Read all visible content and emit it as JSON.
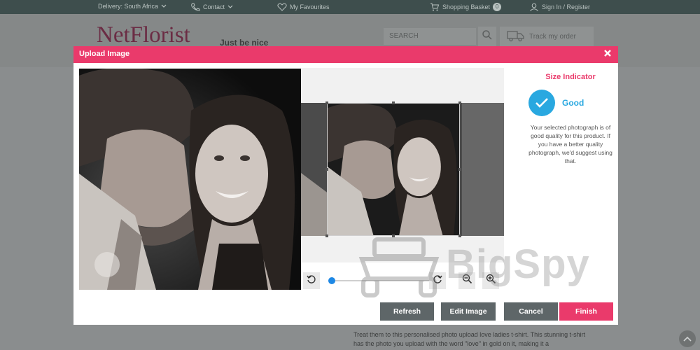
{
  "topbar": {
    "delivery": "Delivery: South Africa",
    "contact": "Contact",
    "favourites": "My Favourites",
    "basket": "Shopping Basket",
    "basket_count": "0",
    "signin": "Sign In / Register"
  },
  "header": {
    "logo": "NetFlorist",
    "tagline": "Just be nice",
    "search_placeholder": "SEARCH",
    "track_label": "Track my order"
  },
  "modal": {
    "title": "Upload Image",
    "size_indicator": {
      "title": "Size Indicator",
      "status": "Good",
      "message": "Your selected photograph is of good quality for this product. If you have a better quality photograph, we'd suggest using that."
    },
    "zoom_level": 0.0,
    "buttons": {
      "refresh": "Refresh",
      "edit_image": "Edit Image",
      "cancel": "Cancel",
      "finish": "Finish"
    }
  },
  "page": {
    "description": "Treat them to this personalised photo upload love ladies t-shirt. This stunning t-shirt has the photo you upload with the word \"love\" in gold on it, making it a"
  },
  "watermark": "BigSpy",
  "colors": {
    "accent": "#ea3a6b",
    "good": "#29a8e0",
    "button_gray": "#5e6668",
    "topbar": "#3e4e4d"
  }
}
